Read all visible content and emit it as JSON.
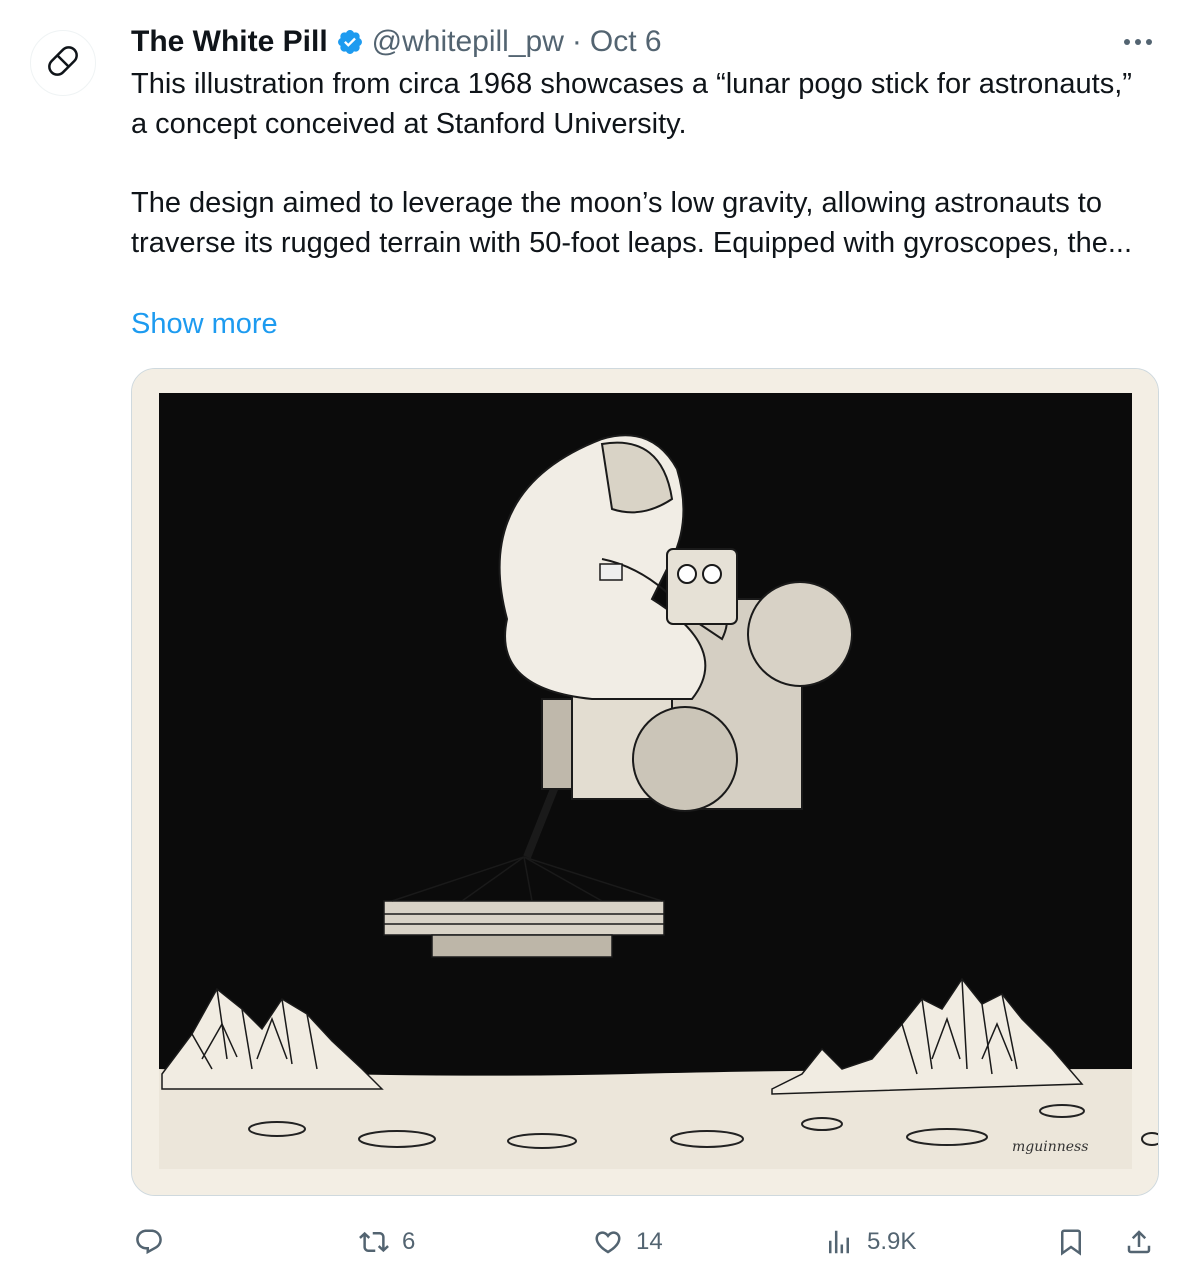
{
  "author": {
    "display_name": "The White Pill",
    "handle": "@whitepill_pw",
    "separator": "·",
    "timestamp": "Oct 6",
    "verified": true,
    "avatar_icon": "pill-icon"
  },
  "more_icon": "more-horizontal-icon",
  "tweet": {
    "paragraph_1": "This illustration from circa 1968 showcases a “lunar pogo stick for astronauts,” a concept conceived at Stanford University.",
    "paragraph_2": "The design aimed to leverage the moon’s low gravity, allowing astronauts to traverse its rugged terrain with 50-foot leaps. Equipped with gyroscopes, the...",
    "show_more": "Show more"
  },
  "media": {
    "signature": "mguinness"
  },
  "actions": {
    "reply": {
      "icon": "reply-icon",
      "count": ""
    },
    "repost": {
      "icon": "repost-icon",
      "count": "6"
    },
    "like": {
      "icon": "heart-icon",
      "count": "14"
    },
    "views": {
      "icon": "analytics-icon",
      "count": "5.9K"
    },
    "bookmark": {
      "icon": "bookmark-icon"
    },
    "share": {
      "icon": "share-icon"
    }
  },
  "colors": {
    "text": "#0f1419",
    "secondary": "#536471",
    "link": "#1d9bf0",
    "verified": "#1d9bf0"
  }
}
